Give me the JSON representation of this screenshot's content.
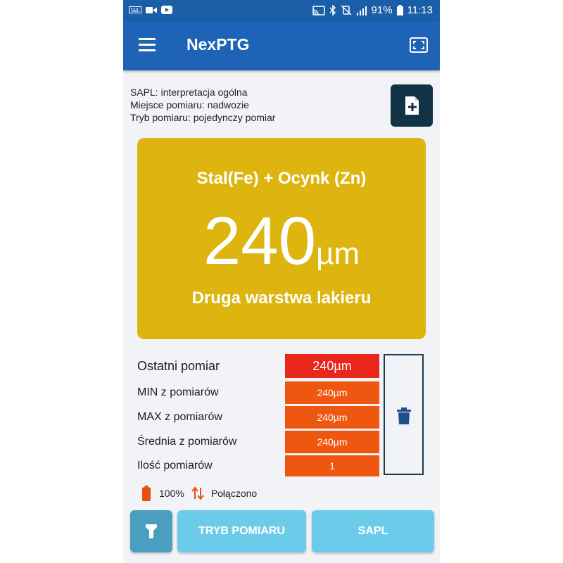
{
  "status_bar": {
    "battery_percent": "91%",
    "time": "11:13"
  },
  "app": {
    "title": "NexPTG"
  },
  "info": {
    "sapl": "SAPL: interpretacja ogólna",
    "location": "Miejsce pomiaru: nadwozie",
    "mode": "Tryb pomiaru: pojedynczy pomiar"
  },
  "result": {
    "material": "Stal(Fe) + Ocynk (Zn)",
    "value": "240",
    "unit": "µm",
    "interpretation": "Druga warstwa lakieru",
    "color": "#ddb50e"
  },
  "stats": [
    {
      "label": "Ostatni pomiar",
      "value": "240µm"
    },
    {
      "label": "MIN z pomiarów",
      "value": "240µm"
    },
    {
      "label": "MAX z pomiarów",
      "value": "240µm"
    },
    {
      "label": "Średnia z pomiarów",
      "value": "240µm"
    },
    {
      "label": "Ilość pomiarów",
      "value": "1"
    }
  ],
  "colors": {
    "primary": "#1e63b5",
    "last_value_bg": "#e8261c",
    "value_bg": "#ef5711",
    "button_light": "#6ccbe8",
    "button_dark": "#4a9fc0"
  },
  "device": {
    "battery": "100%",
    "connection": "Połączono"
  },
  "buttons": {
    "mode": "TRYB POMIARU",
    "sapl": "SAPL"
  },
  "icons": [
    "menu-icon",
    "fullscreen-icon",
    "new-file-icon",
    "trash-icon",
    "battery-icon",
    "transfer-arrows-icon",
    "flashlight-icon"
  ]
}
